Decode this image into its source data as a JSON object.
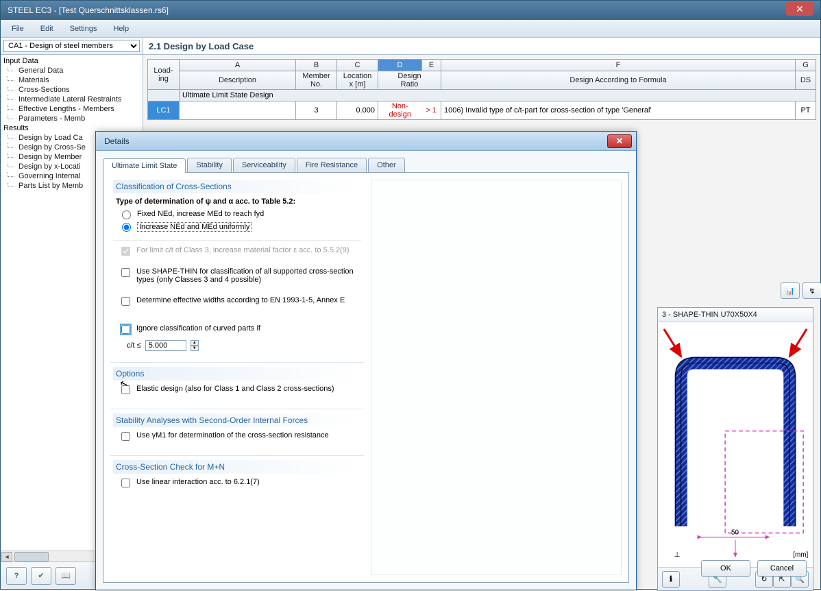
{
  "window": {
    "title": "STEEL EC3 - [Test Querschnittsklassen.rs6]"
  },
  "menu": {
    "file": "File",
    "edit": "Edit",
    "settings": "Settings",
    "help": "Help"
  },
  "combo": {
    "selected": "CA1 - Design of steel members"
  },
  "page_heading": "2.1 Design by Load Case",
  "tree": {
    "input": "Input Data",
    "input_items": [
      "General Data",
      "Materials",
      "Cross-Sections",
      "Intermediate Lateral Restraints",
      "Effective Lengths - Members",
      "Parameters - Memb"
    ],
    "results": "Results",
    "results_items": [
      "Design by Load Ca",
      "Design by Cross-Se",
      "Design by Member",
      "Design by x-Locati",
      "Governing Internal",
      "Parts List by Memb"
    ]
  },
  "table": {
    "col_letters": [
      "A",
      "B",
      "C",
      "D",
      "E",
      "F",
      "G"
    ],
    "head": {
      "loading": "Load-\ning",
      "description": "Description",
      "member_no": "Member\nNo.",
      "location": "Location\nx [m]",
      "design_ratio": "Design\nRatio",
      "design_formula": "Design According to Formula",
      "ds": "DS"
    },
    "section_row": "Ultimate Limit State Design",
    "row": {
      "lc": "LC1",
      "member": "3",
      "location": "0.000",
      "ratio_text": "Non-design",
      "ratio_symbol": "> 1",
      "formula": "1006) Invalid type of c/t-part for cross-section of type 'General'",
      "ds": "PT"
    }
  },
  "shape": {
    "title": "3 - SHAPE-THIN U70X50X4",
    "dim": "50",
    "unit": "[mm]"
  },
  "buttons": {
    "ok": "OK",
    "cancel": "Cancel"
  },
  "dialog": {
    "title": "Details",
    "tabs": {
      "uls": "Ultimate Limit State",
      "stability": "Stability",
      "serviceability": "Serviceability",
      "fire": "Fire Resistance",
      "other": "Other"
    },
    "grp1": {
      "title": "Classification of Cross-Sections",
      "subtitle": "Type of determination of ψ and α acc. to Table 5.2:",
      "radio1": "Fixed NEd, increase MEd to reach fyd",
      "radio2": "Increase NEd and MEd uniformly",
      "chk_limit": "For limit c/t of Class 3, increase material factor ε acc. to 5.5.2(9)",
      "chk_shapethin": "Use SHAPE-THIN for classification of all supported cross-section types (only Classes 3 and 4 possible)",
      "chk_annexe": "Determine effective widths according to EN 1993-1-5, Annex E",
      "chk_ignore": "Ignore classification of curved parts if",
      "ct_label": "c/t ≤",
      "ct_value": "5.000"
    },
    "grp2": {
      "title": "Options",
      "chk_elastic": "Elastic design (also for Class 1 and Class 2 cross-sections)"
    },
    "grp3": {
      "title": "Stability Analyses with Second-Order Internal Forces",
      "chk_gamma": "Use γM1 for determination of the cross-section resistance"
    },
    "grp4": {
      "title": "Cross-Section Check for M+N",
      "chk_linear": "Use linear interaction acc. to 6.2.1(7)"
    }
  }
}
